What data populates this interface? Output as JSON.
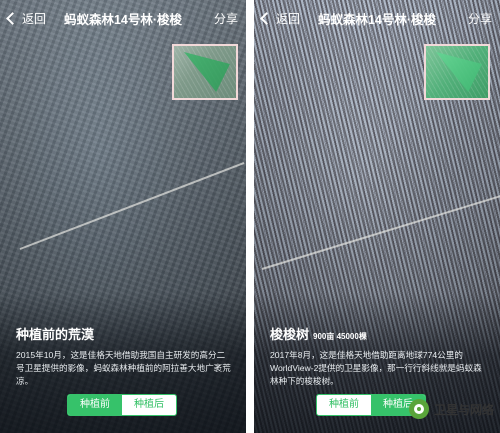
{
  "left": {
    "nav": {
      "back": "返回",
      "title": "蚂蚁森林14号林·梭梭",
      "share": "分享"
    },
    "caption": {
      "title": "种植前的荒漠",
      "subtitle": "",
      "text": "2015年10月，这是佳格天地借助我国自主研发的高分二号卫星提供的影像，蚂蚁森林种植前的阿拉善大地广袤荒凉。"
    },
    "toggle": {
      "before": "种植前",
      "after": "种植后",
      "selected": "before"
    }
  },
  "right": {
    "nav": {
      "back": "返回",
      "title": "蚂蚁森林14号林·梭梭",
      "share": "分享"
    },
    "caption": {
      "title": "梭梭树",
      "subtitle": "900亩 45000棵",
      "text": "2017年8月，这是佳格天地借助距离地球774公里的WorldView-2提供的卫星影像，那一行行斜线就是蚂蚁森林种下的梭梭树。"
    },
    "toggle": {
      "before": "种植前",
      "after": "种植后",
      "selected": "after"
    }
  },
  "watermark": {
    "text": "卫星与网络"
  },
  "colors": {
    "accent": "#36c26a",
    "thumb_border": "#f2d9d9"
  }
}
